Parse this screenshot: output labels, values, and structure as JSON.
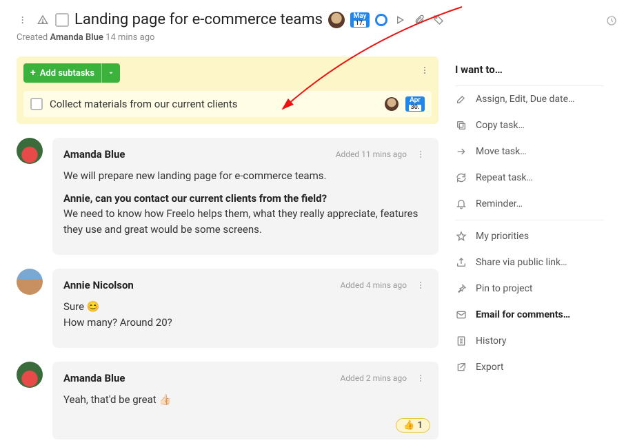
{
  "header": {
    "title": "Landing page for e-commerce teams",
    "date_chip": {
      "month": "May",
      "day": "17."
    }
  },
  "meta": {
    "prefix": "Created",
    "creator": "Amanda Blue",
    "time_ago": "14 mins ago"
  },
  "subtasks": {
    "add_label": "Add subtasks",
    "items": [
      {
        "label": "Collect materials from our current clients",
        "date": {
          "month": "Apr",
          "day": "30."
        }
      }
    ]
  },
  "comments": [
    {
      "author": "Amanda Blue",
      "time": "Added 11 mins ago",
      "html_lines": [
        "We will prepare new landing page for e-commerce teams.",
        "<strong>Annie, can you contact our current clients from the field?</strong><br>We need to know how Freelo helps them, what they really appreciate, features they use and great would be some screens."
      ]
    },
    {
      "author": "Annie Nicolson",
      "time": "Added 4 mins ago",
      "html_lines": [
        "Sure 😊<br>How many? Around 20?"
      ]
    },
    {
      "author": "Amanda Blue",
      "time": "Added 2 mins ago",
      "html_lines": [
        "Yeah, that'd be great 👍🏻"
      ],
      "reaction": {
        "emoji": "👍",
        "count": "1"
      }
    }
  ],
  "sidebar": {
    "heading": "I want to…",
    "items": [
      {
        "label": "Assign, Edit, Due date…",
        "icon": "pencil"
      },
      {
        "label": "Copy task…",
        "icon": "copy"
      },
      {
        "label": "Move task…",
        "icon": "arrow-right"
      },
      {
        "label": "Repeat task…",
        "icon": "refresh"
      },
      {
        "label": "Reminder…",
        "icon": "bell",
        "divider_after": true
      },
      {
        "label": "My priorities",
        "icon": "star"
      },
      {
        "label": "Share via public link…",
        "icon": "share"
      },
      {
        "label": "Pin to project",
        "icon": "pin"
      },
      {
        "label": "Email for comments…",
        "icon": "mail",
        "bold": true
      },
      {
        "label": "History",
        "icon": "doc"
      },
      {
        "label": "Export",
        "icon": "export"
      }
    ]
  }
}
